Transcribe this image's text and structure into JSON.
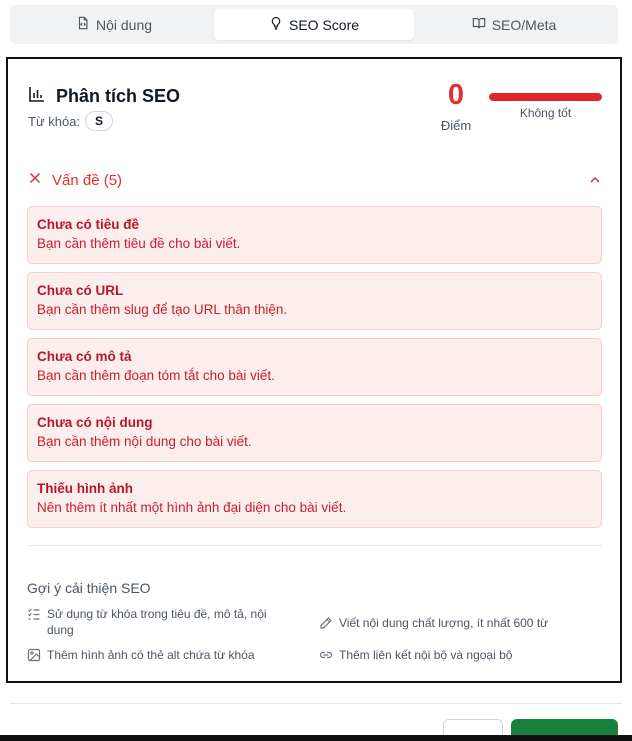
{
  "tabs": [
    {
      "label": "Nội dung",
      "icon": "file-code-icon",
      "active": false
    },
    {
      "label": "SEO Score",
      "icon": "lightbulb-icon",
      "active": true
    },
    {
      "label": "SEO/Meta",
      "icon": "book-open-icon",
      "active": false
    }
  ],
  "seo": {
    "title": "Phân tích SEO",
    "keyword_label": "Từ khóa:",
    "keyword": "S",
    "score": "0",
    "score_label": "Điểm",
    "score_percent": 100,
    "rating": "Không tốt",
    "colors": {
      "bad": "#e03131",
      "bar": "#e0252d",
      "issue_bg": "#fdeeee"
    }
  },
  "issues": {
    "header": "Vấn đề (5)",
    "items": [
      {
        "title": "Chưa có tiêu đề",
        "desc": "Bạn cần thêm tiêu đề cho bài viết."
      },
      {
        "title": "Chưa có URL",
        "desc": "Bạn cần thêm slug để tạo URL thân thiện."
      },
      {
        "title": "Chưa có mô tả",
        "desc": "Bạn cần thêm đoạn tóm tắt cho bài viết."
      },
      {
        "title": "Chưa có nội dung",
        "desc": "Bạn cần thêm nội dung cho bài viết."
      },
      {
        "title": "Thiếu hình ảnh",
        "desc": "Nên thêm ít nhất một hình ảnh đại diện cho bài viết."
      }
    ]
  },
  "tips": {
    "title": "Gợi ý cải thiện SEO",
    "items": [
      {
        "text": "Sử dụng từ khóa trong tiêu đề, mô tả, nội dung",
        "icon": "list-check-icon"
      },
      {
        "text": "Viết nội dung chất lượng, ít nhất 600 từ",
        "icon": "pencil-icon"
      },
      {
        "text": "Thêm hình ảnh có thẻ alt chứa từ khóa",
        "icon": "image-icon"
      },
      {
        "text": "Thêm liên kết nội bộ và ngoại bộ",
        "icon": "link-icon"
      }
    ]
  }
}
